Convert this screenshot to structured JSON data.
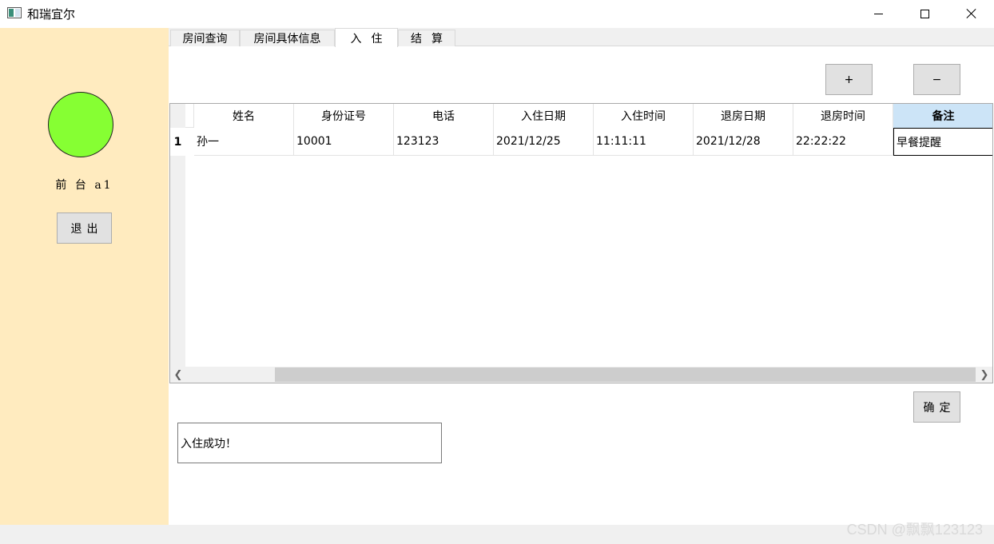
{
  "window": {
    "title": "和瑞宜尔",
    "icon": "app-window-icon"
  },
  "sidebar": {
    "status_color": "#86ff33",
    "user_label": "前 台 a1",
    "logout_label": "退出"
  },
  "tabs": [
    {
      "label": "房间查询"
    },
    {
      "label": "房间具体信息"
    },
    {
      "label": "入住"
    },
    {
      "label": "结算"
    }
  ],
  "active_tab": 2,
  "toolbar": {
    "add_label": "+",
    "remove_label": "−"
  },
  "table": {
    "columns": [
      "姓名",
      "身份证号",
      "电话",
      "入住日期",
      "入住时间",
      "退房日期",
      "退房时间",
      "备注"
    ],
    "rows": [
      {
        "row_number": "1",
        "cells": [
          "孙一",
          "10001",
          "123123",
          "2021/12/25",
          "11:11:11",
          "2021/12/28",
          "22:22:22",
          "早餐提醒"
        ]
      }
    ]
  },
  "confirm_label": "确定",
  "message": "入住成功！",
  "watermark": "CSDN @飘飘123123",
  "colors": {
    "sidebar_bg": "#ffebbf",
    "selected_header": "#cce4f7"
  }
}
